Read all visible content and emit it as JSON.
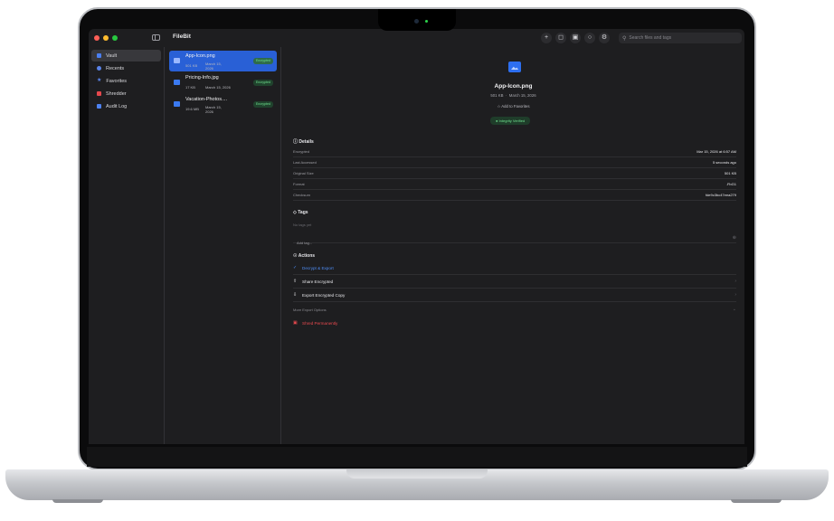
{
  "app": {
    "title": "FileBit"
  },
  "toolbar": {
    "icons": [
      "plus-icon",
      "unlock-icon",
      "trash-icon",
      "lock-person-icon",
      "settings-icon"
    ],
    "search_placeholder": "Search files and tags"
  },
  "sidebar": {
    "items": [
      {
        "label": "Vault",
        "icon": "vault-icon",
        "active": true
      },
      {
        "label": "Recents",
        "icon": "clock-icon",
        "active": false
      },
      {
        "label": "Favorites",
        "icon": "star-icon",
        "active": false
      },
      {
        "label": "Shredder",
        "icon": "shredder-icon",
        "active": false
      },
      {
        "label": "Audit Log",
        "icon": "audit-log-icon",
        "active": false
      }
    ]
  },
  "files": [
    {
      "name": "App-Icon.png",
      "size": "501 KB",
      "date": "March 15, 2026",
      "badge": "Encrypted",
      "active": true
    },
    {
      "name": "Pricing-Info.jpg",
      "size": "17 KB",
      "date": "March 15, 2026",
      "badge": "Encrypted",
      "active": false
    },
    {
      "name": "Vacation-Photos....",
      "size": "19.6 MB",
      "date": "March 15, 2026",
      "badge": "Encrypted",
      "active": false
    }
  ],
  "detail": {
    "name": "App-Icon.png",
    "size": "501 KB",
    "date": "March 15, 2026",
    "favorite_label": "Add to Favorites",
    "integrity_label": "Integrity Verified",
    "details_header": "Details",
    "details": [
      {
        "key": "Encrypted",
        "value": "Mar 15, 2026 at 6:57 AM"
      },
      {
        "key": "Last Accessed",
        "value": "5 seconds ago"
      },
      {
        "key": "Original Size",
        "value": "501 KB"
      },
      {
        "key": "Format",
        "value": ".FbG1"
      },
      {
        "key": "Checksum",
        "value": "fde9c3bc47eea279"
      }
    ],
    "tags_header": "Tags",
    "no_tags": "No tags yet",
    "add_tag_placeholder": "Add tag...",
    "actions_header": "Actions",
    "actions": {
      "decrypt": "Decrypt & Export",
      "share": "Share Encrypted",
      "export_copy": "Export Encrypted Copy",
      "more": "More Export Options",
      "shred": "Shred Permanently"
    }
  }
}
